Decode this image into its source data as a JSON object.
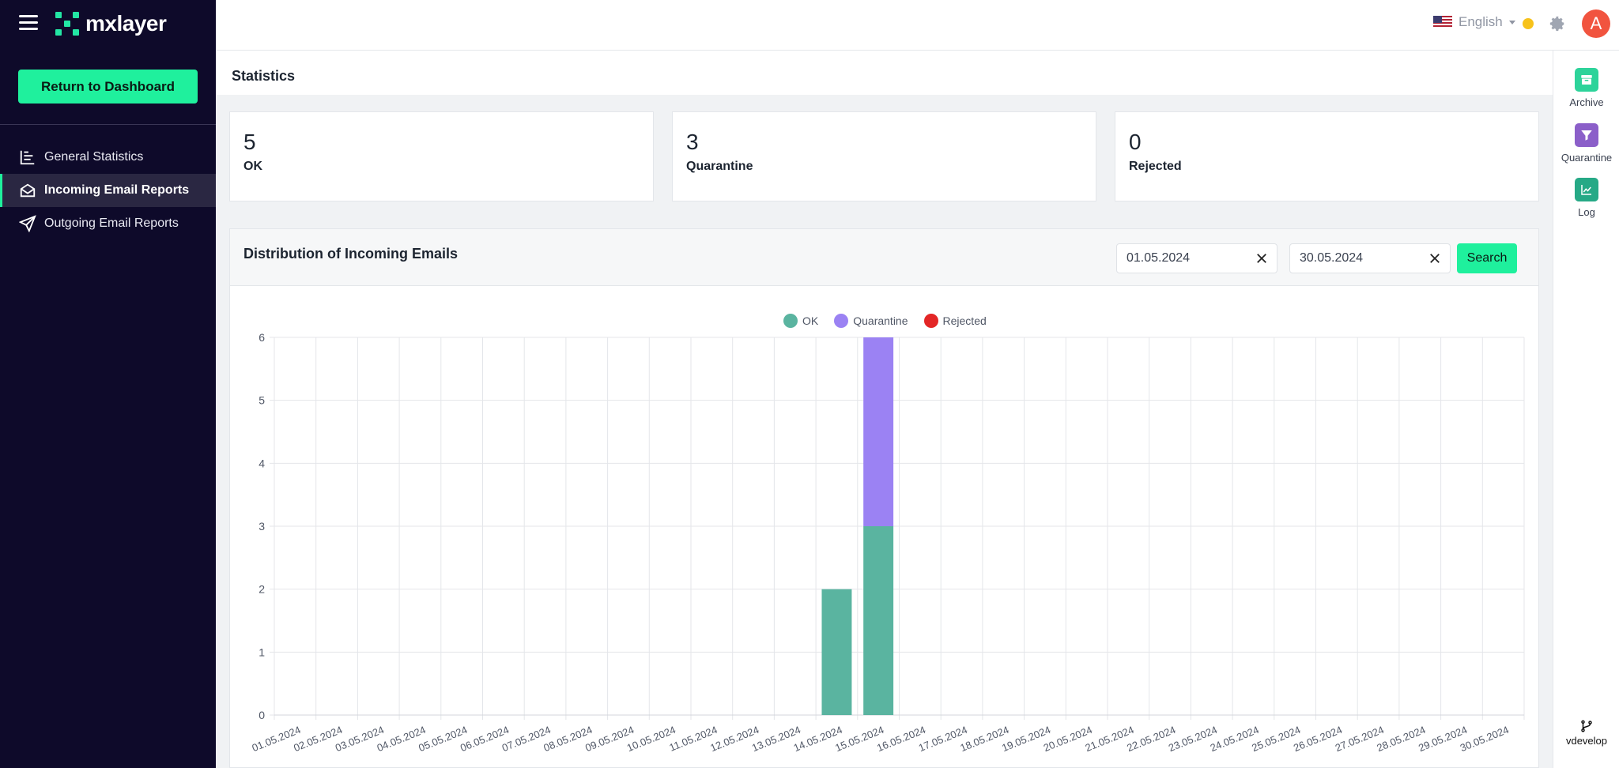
{
  "app": {
    "logo_text": "mxlayer"
  },
  "sidebar": {
    "return_button": "Return to Dashboard",
    "items": [
      {
        "label": "General Statistics",
        "icon": "chart-icon"
      },
      {
        "label": "Incoming Email Reports",
        "icon": "envelope-open-icon",
        "active": true
      },
      {
        "label": "Outgoing Email Reports",
        "icon": "send-icon"
      }
    ]
  },
  "topbar": {
    "language": "English",
    "status_color": "#f7c21b",
    "avatar_letter": "A"
  },
  "rail": {
    "items": [
      {
        "label": "Archive",
        "color": "#2dd39a",
        "icon": "archive-icon"
      },
      {
        "label": "Quarantine",
        "color": "#8b5fc9",
        "icon": "filter-icon"
      },
      {
        "label": "Log",
        "color": "#26a986",
        "icon": "log-chart-icon"
      }
    ],
    "footer": "vdevelop"
  },
  "page": {
    "title": "Statistics"
  },
  "stats": [
    {
      "value": "5",
      "label": "OK"
    },
    {
      "value": "3",
      "label": "Quarantine"
    },
    {
      "value": "0",
      "label": "Rejected"
    }
  ],
  "panel": {
    "title": "Distribution of Incoming Emails",
    "date_from": "01.05.2024",
    "date_to": "30.05.2024",
    "search_label": "Search"
  },
  "chart_data": {
    "type": "bar",
    "stacked": true,
    "title": "",
    "xlabel": "",
    "ylabel": "",
    "ylim": [
      0,
      6
    ],
    "yticks": [
      0,
      1,
      2,
      3,
      4,
      5,
      6
    ],
    "grid": true,
    "legend_position": "top-center",
    "categories": [
      "01.05.2024",
      "02.05.2024",
      "03.05.2024",
      "04.05.2024",
      "05.05.2024",
      "06.05.2024",
      "07.05.2024",
      "08.05.2024",
      "09.05.2024",
      "10.05.2024",
      "11.05.2024",
      "12.05.2024",
      "13.05.2024",
      "14.05.2024",
      "15.05.2024",
      "16.05.2024",
      "17.05.2024",
      "18.05.2024",
      "19.05.2024",
      "20.05.2024",
      "21.05.2024",
      "22.05.2024",
      "23.05.2024",
      "24.05.2024",
      "25.05.2024",
      "26.05.2024",
      "27.05.2024",
      "28.05.2024",
      "29.05.2024",
      "30.05.2024"
    ],
    "series": [
      {
        "name": "OK",
        "color": "#5ab4a0",
        "values": [
          0,
          0,
          0,
          0,
          0,
          0,
          0,
          0,
          0,
          0,
          0,
          0,
          0,
          2,
          3,
          0,
          0,
          0,
          0,
          0,
          0,
          0,
          0,
          0,
          0,
          0,
          0,
          0,
          0,
          0
        ]
      },
      {
        "name": "Quarantine",
        "color": "#9b82f3",
        "values": [
          0,
          0,
          0,
          0,
          0,
          0,
          0,
          0,
          0,
          0,
          0,
          0,
          0,
          0,
          3,
          0,
          0,
          0,
          0,
          0,
          0,
          0,
          0,
          0,
          0,
          0,
          0,
          0,
          0,
          0
        ]
      },
      {
        "name": "Rejected",
        "color": "#e32626",
        "values": [
          0,
          0,
          0,
          0,
          0,
          0,
          0,
          0,
          0,
          0,
          0,
          0,
          0,
          0,
          0,
          0,
          0,
          0,
          0,
          0,
          0,
          0,
          0,
          0,
          0,
          0,
          0,
          0,
          0,
          0
        ]
      }
    ]
  }
}
